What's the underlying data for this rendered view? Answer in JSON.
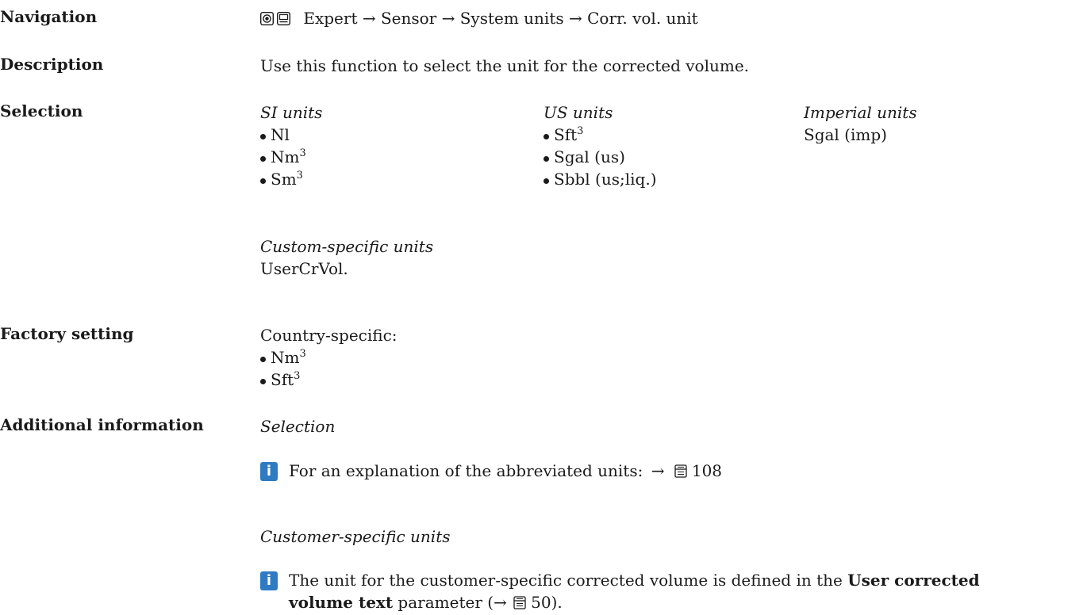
{
  "rows": {
    "navigation": {
      "label": "Navigation",
      "icons": [
        "operating-keys-icon",
        "display-icon"
      ],
      "path": "Expert → Sensor → System units → Corr. vol. unit"
    },
    "description": {
      "label": "Description",
      "text": "Use this function to select the unit for the corrected volume."
    },
    "selection": {
      "label": "Selection",
      "si": {
        "title": "SI units",
        "items": [
          [
            "Nl",
            ""
          ],
          [
            "Nm",
            "3"
          ],
          [
            "Sm",
            "3"
          ]
        ]
      },
      "us": {
        "title": "US units",
        "items": [
          [
            "Sft",
            "3"
          ],
          [
            "Sgal (us)",
            ""
          ],
          [
            "Sbbl (us;liq.)",
            ""
          ]
        ]
      },
      "imperial": {
        "title": "Imperial units",
        "value": "Sgal (imp)"
      },
      "custom": {
        "title": "Custom-specific units",
        "value": "UserCrVol."
      }
    },
    "factory": {
      "label": "Factory setting",
      "intro": "Country-specific:",
      "items": [
        [
          "Nm",
          "3"
        ],
        [
          "Sft",
          "3"
        ]
      ]
    },
    "additional": {
      "label": "Additional information",
      "section1_title": "Selection",
      "note1_text": "For an explanation of the abbreviated units:",
      "note1_arrow": "→",
      "note1_page": "108",
      "section2_title": "Customer-specific units",
      "note2_line1_pre": "The unit for the customer-specific corrected volume is defined in the ",
      "note2_bold1": "User corrected",
      "note2_bold2": "volume text",
      "note2_line2_mid": " parameter (→ ",
      "note2_page": "50",
      "note2_line2_end": ")."
    }
  },
  "colors": {
    "info_icon": "#2e7bc4",
    "text": "#1a1a1a"
  }
}
